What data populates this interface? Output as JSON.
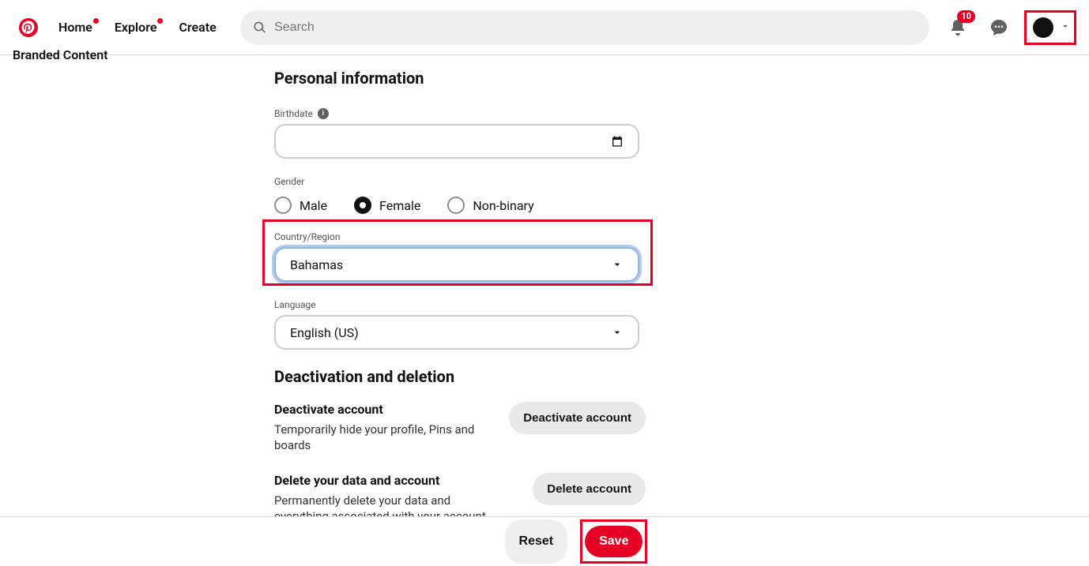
{
  "header": {
    "nav": {
      "home": "Home",
      "explore": "Explore",
      "create": "Create"
    },
    "search_placeholder": "Search",
    "notification_count": "10"
  },
  "sidebar": {
    "branded_content": "Branded Content"
  },
  "personal": {
    "title": "Personal information",
    "birthdate_label": "Birthdate",
    "gender_label": "Gender",
    "gender_options": {
      "male": "Male",
      "female": "Female",
      "nonbinary": "Non-binary"
    },
    "gender_selected": "female",
    "country_label": "Country/Region",
    "country_value": "Bahamas",
    "language_label": "Language",
    "language_value": "English (US)"
  },
  "deactivation": {
    "title": "Deactivation and deletion",
    "deactivate_title": "Deactivate account",
    "deactivate_desc": "Temporarily hide your profile, Pins and boards",
    "deactivate_btn": "Deactivate account",
    "delete_title": "Delete your data and account",
    "delete_desc": "Permanently delete your data and everything associated with your account",
    "delete_btn": "Delete account"
  },
  "footer": {
    "reset": "Reset",
    "save": "Save"
  }
}
